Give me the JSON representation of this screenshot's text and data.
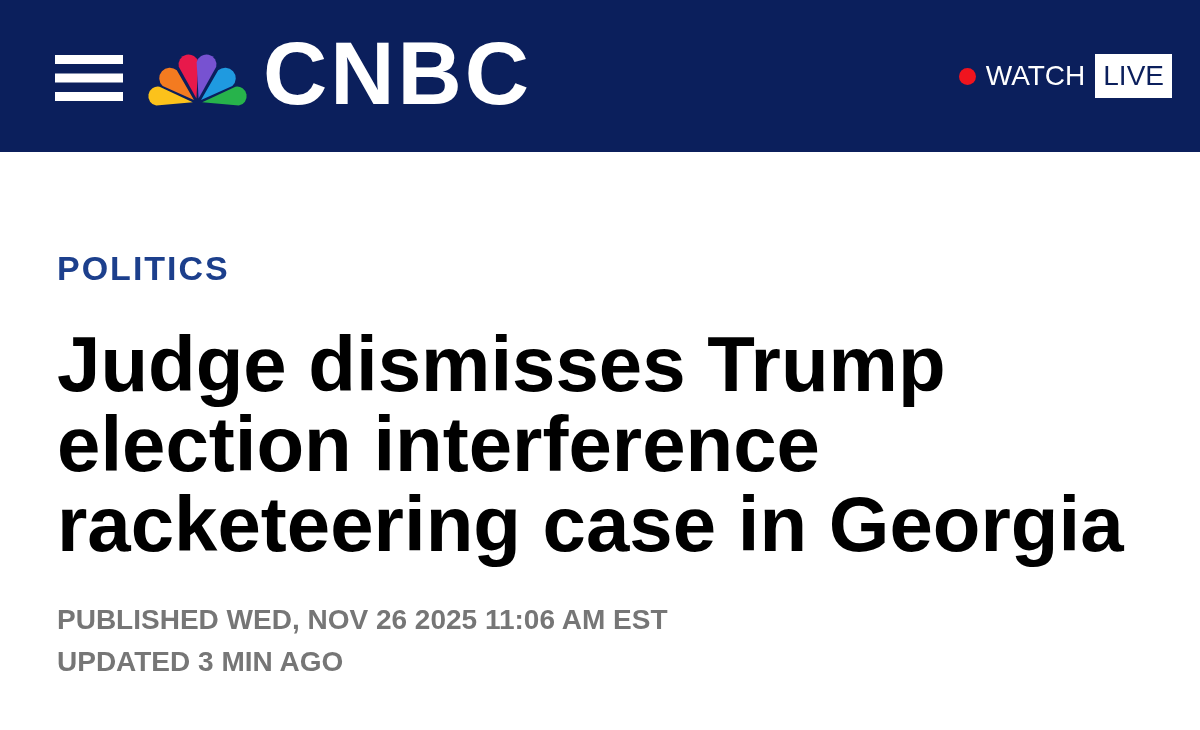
{
  "header": {
    "logo": "CNBC",
    "watch_live": {
      "label": "WATCH",
      "badge": "LIVE"
    }
  },
  "article": {
    "section": "POLITICS",
    "headline": "Judge dismisses Trump election interference racketeering case in Georgia",
    "published": "PUBLISHED WED, NOV 26 2025 11:06 AM EST",
    "updated": "UPDATED 3 MIN AGO"
  }
}
